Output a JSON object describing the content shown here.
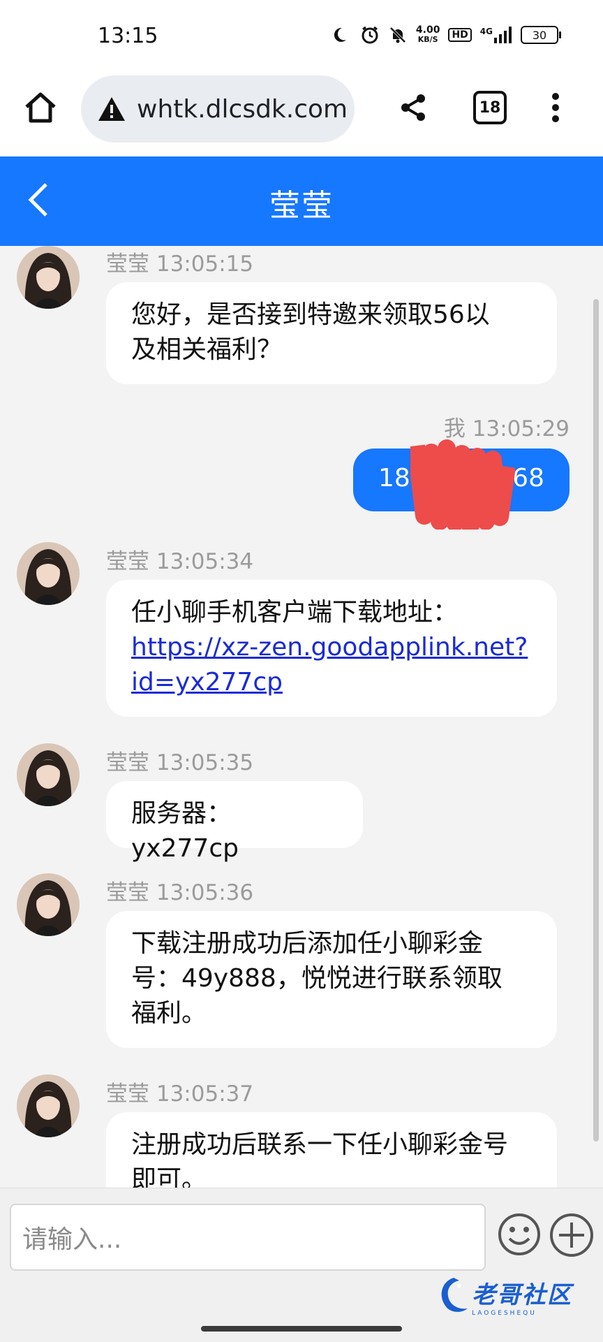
{
  "status_bar": {
    "time": "13:15",
    "net_speed_value": "4.00",
    "net_speed_unit": "KB/S",
    "hd_label": "HD",
    "network_label": "4G",
    "battery": "30"
  },
  "browser": {
    "url": "whtk.dlcsdk.com",
    "tab_count": "18"
  },
  "chat_header": {
    "title": "莹莹"
  },
  "messages": [
    {
      "sender": "莹莹",
      "time": "13:05:15",
      "meta": "莹莹 13:05:15",
      "lines": [
        "您好，是否接到特邀来领取56以",
        "及相关福利？"
      ]
    },
    {
      "sender": "我",
      "time": "13:05:29",
      "meta": "我 13:05:29",
      "text_left": "18",
      "text_right": "868"
    },
    {
      "sender": "莹莹",
      "time": "13:05:34",
      "meta": "莹莹 13:05:34",
      "text": "任小聊手机客户端下载地址：",
      "link_line1": "https://xz-zen.goodapplink.net?",
      "link_line2": "id=yx277cp"
    },
    {
      "sender": "莹莹",
      "time": "13:05:35",
      "meta": "莹莹 13:05:35",
      "text": "服务器：yx277cp"
    },
    {
      "sender": "莹莹",
      "time": "13:05:36",
      "meta": "莹莹 13:05:36",
      "lines": [
        "下载注册成功后添加任小聊彩金",
        "号：49y888，悦悦进行联系领取",
        "福利。"
      ]
    },
    {
      "sender": "莹莹",
      "time": "13:05:37",
      "meta": "莹莹 13:05:37",
      "lines": [
        "注册成功后联系一下任小聊彩金号",
        "即可。"
      ]
    }
  ],
  "input": {
    "placeholder": "请输入..."
  },
  "watermark": {
    "text": "老哥社区",
    "sub": "LAOGESHEQU"
  },
  "colors": {
    "accent": "#1677ff",
    "link": "#1a2bd6",
    "redaction": "#ee4b4b"
  }
}
